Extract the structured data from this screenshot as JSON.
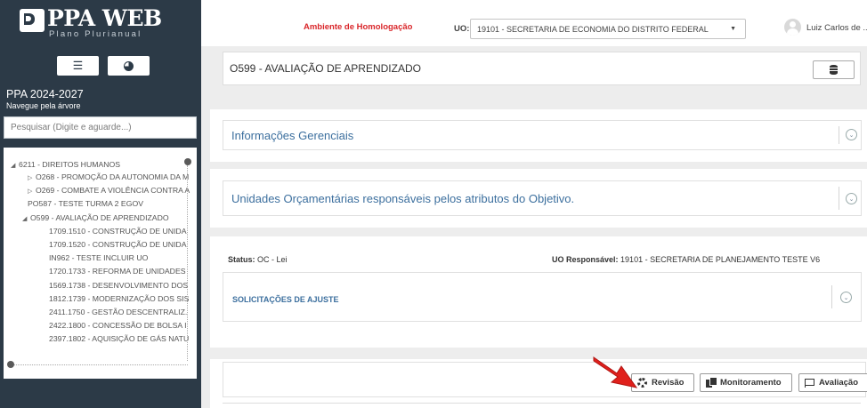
{
  "sidebar": {
    "logo_title": "PPA WEB",
    "logo_subtitle": "Plano Plurianual",
    "ppa_title": "PPA 2024-2027",
    "ppa_subtitle": "Navegue pela árvore",
    "search_placeholder": "Pesquisar (Digite e aguarde...)",
    "tree": [
      "6211 - DIREITOS HUMANOS",
      "O268 - PROMOÇÃO DA AUTONOMIA DA M",
      "O269 - COMBATE A VIOLÊNCIA CONTRA A",
      "PO587 - TESTE TURMA 2 EGOV",
      "O599 - AVALIAÇÃO DE APRENDIZADO",
      "1709.1510 - CONSTRUÇÃO DE UNIDA",
      "1709.1520 - CONSTRUÇÃO DE UNIDA",
      "IN962 - TESTE INCLUIR UO",
      "1720.1733 - REFORMA DE UNIDADES",
      "1569.1738 - DESENVOLVIMENTO DOS",
      "1812.1739 - MODERNIZAÇÃO DOS SIS",
      "2411.1750 - GESTÃO DESCENTRALIZ.",
      "2422.1800 - CONCESSÃO DE BOLSA I",
      "2397.1802 - AQUISIÇÃO DE GÁS NATU"
    ]
  },
  "header": {
    "ambiente": "Ambiente de Homologação",
    "uo_label": "UO:",
    "uo_value": "19101 - SECRETARIA DE ECONOMIA DO DISTRITO FEDERAL",
    "user_name": "Luiz Carlos de ..."
  },
  "main": {
    "objective_title": "O599 - AVALIAÇÃO DE APRENDIZADO",
    "info_panel_title": "Informações Gerenciais",
    "uos_panel_title": "Unidades Orçamentárias responsáveis pelos atributos do Objetivo.",
    "status_label": "Status:",
    "status_value": "OC - Lei",
    "uo_resp_label": "UO Responsável:",
    "uo_resp_value": "19101 - SECRETARIA DE PLANEJAMENTO TESTE V6",
    "solicitacoes_title": "SOLICITAÇÕES DE AJUSTE",
    "buttons": {
      "revisao": "Revisão",
      "monitoramento": "Monitoramento",
      "avaliacao": "Avaliação"
    }
  },
  "colors": {
    "sidebar_bg": "#2c3a47",
    "accent_blue": "#3c6f9e",
    "ambiente_red": "#d9262a",
    "arrow_red": "#e0201c"
  },
  "icons": [
    "menu-icon",
    "pie-chart-icon",
    "database-icon",
    "chevron-down-icon",
    "gear-icon",
    "copy-icon",
    "flag-icon",
    "user-icon"
  ]
}
